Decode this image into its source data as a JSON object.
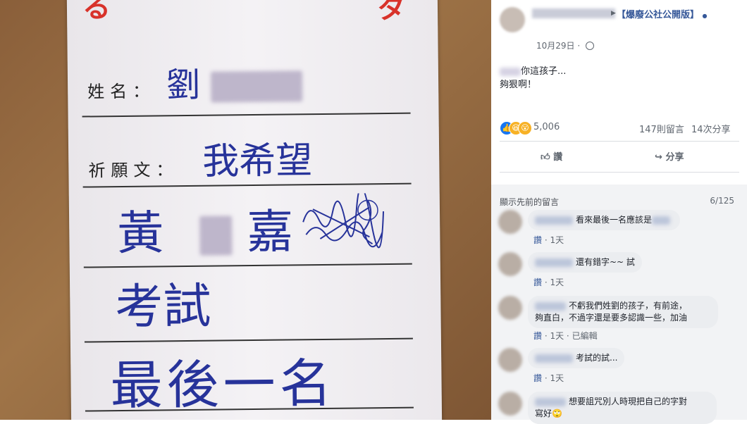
{
  "photo": {
    "card_labels": {
      "name": "姓名：",
      "wish": "祈願文："
    },
    "handwriting": {
      "surname": "劉",
      "line1": "我希望",
      "line2_a": "黃",
      "line2_b": "嘉",
      "line3": "考試",
      "line4": "最後一名"
    }
  },
  "post": {
    "page_name": "【爆廢公社公開版】",
    "date": "10月29日",
    "text_line1": "你這孩子...",
    "text_line2": "夠狠啊！",
    "reaction_count": "5,006",
    "comment_count": "147則留言",
    "share_count": "14次分享",
    "like_label": "讚",
    "share_label": "分享"
  },
  "comments_header": {
    "more_label": "顯示先前的留言",
    "count": "6/125"
  },
  "comments": [
    {
      "text": "看來最後一名應該是",
      "like": "讚",
      "age": "1天",
      "edited": ""
    },
    {
      "text": "還有錯字~~ 試",
      "like": "讚",
      "age": "1天",
      "edited": ""
    },
    {
      "text": "不虧我們姓劉的孩子，有前途，",
      "text2": "夠直白，不過字還是要多認識一些，加油",
      "like": "讚",
      "age": "1天",
      "edited": "已編輯"
    },
    {
      "text": "考試的試...",
      "like": "讚",
      "age": "1天",
      "edited": ""
    },
    {
      "text": "想要詛咒別人時現把自己的字對",
      "text2": "寫好",
      "like": "",
      "age": "",
      "edited": ""
    }
  ],
  "colors": {
    "link": "#365899",
    "like_blue": "#1877f2",
    "comment_bg": "#f2f3f5"
  }
}
